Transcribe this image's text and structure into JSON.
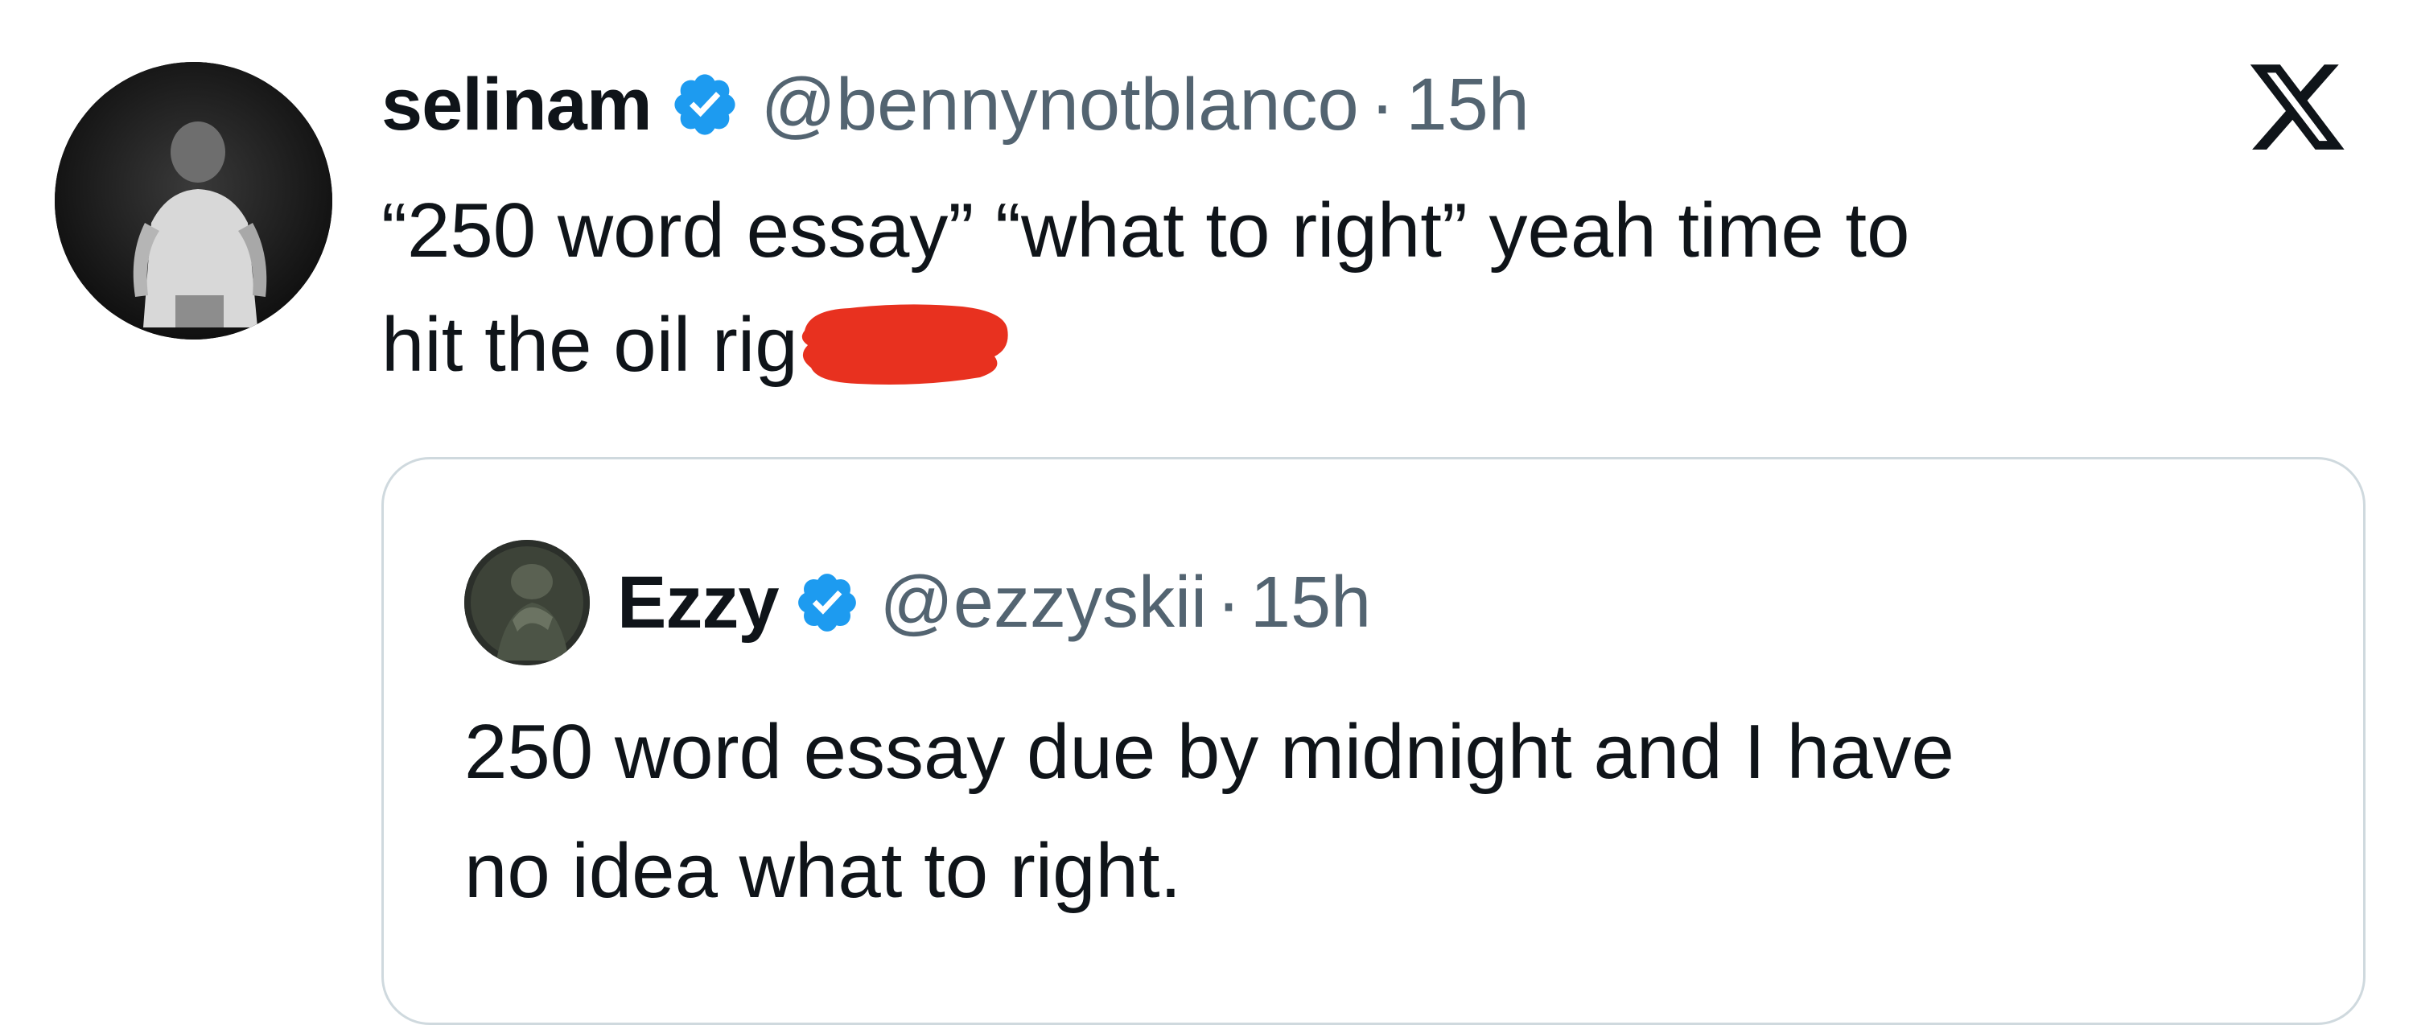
{
  "main_tweet": {
    "display_name": "selinam",
    "handle": "@bennynotblanco",
    "separator": "·",
    "time": "15h",
    "text_line1": "“250 word essay” “what to right” yeah time to",
    "text_line2": "hit the oil rig",
    "redaction_color": "#e8311f",
    "verified_color": "#1d9bf0"
  },
  "platform_logo": "x-logo-icon",
  "quoted_tweet": {
    "display_name": "Ezzy",
    "handle": "@ezzyskii",
    "separator": "·",
    "time": "15h",
    "text_line1": "250 word essay due by midnight and I have",
    "text_line2": "no idea what to right."
  }
}
